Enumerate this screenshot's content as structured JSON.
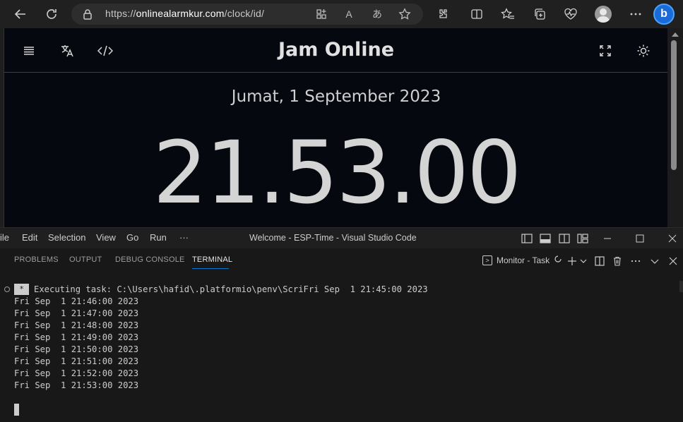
{
  "browser": {
    "url_prefix": "https://",
    "url_host": "onlinealarmkur.com",
    "url_path": "/clock/id/",
    "read_aloud_label": "A",
    "translate_label": "あ",
    "bing_label": "b"
  },
  "page": {
    "title": "Jam Online",
    "date": "Jumat, 1 September 2023",
    "time": "21.53.00"
  },
  "vscode": {
    "menu": [
      "File",
      "Edit",
      "Selection",
      "View",
      "Go",
      "Run",
      "···"
    ],
    "window_title": "Welcome - ESP-Time - Visual Studio Code",
    "panel_tabs": [
      "PROBLEMS",
      "OUTPUT",
      "DEBUG CONSOLE",
      "TERMINAL"
    ],
    "active_tab": "TERMINAL",
    "terminal_task": "Monitor - Task",
    "terminal": {
      "task_badge": "*",
      "first_line": "Executing task: C:\\Users\\hafid\\.platformio\\penv\\ScriFri Sep  1 21:45:00 2023",
      "lines": [
        "Fri Sep  1 21:46:00 2023",
        "Fri Sep  1 21:47:00 2023",
        "Fri Sep  1 21:48:00 2023",
        "Fri Sep  1 21:49:00 2023",
        "Fri Sep  1 21:50:00 2023",
        "Fri Sep  1 21:51:00 2023",
        "Fri Sep  1 21:52:00 2023",
        "Fri Sep  1 21:53:00 2023"
      ]
    }
  }
}
